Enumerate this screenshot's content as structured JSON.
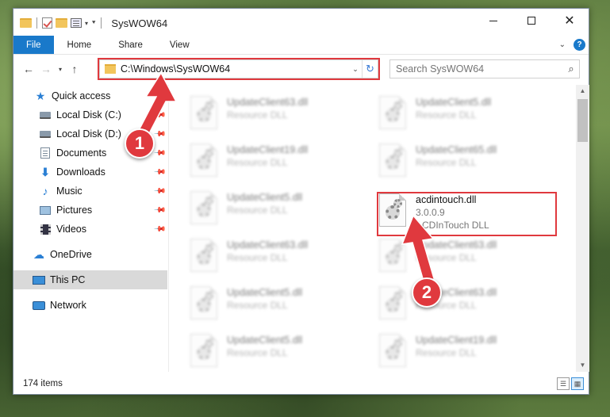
{
  "window": {
    "title": "SysWOW64"
  },
  "ribbon": {
    "tabs": [
      "File",
      "Home",
      "Share",
      "View"
    ]
  },
  "address": {
    "path": "C:\\Windows\\SysWOW64"
  },
  "search": {
    "placeholder": "Search SysWOW64"
  },
  "nav": {
    "quick_access": "Quick access",
    "items": [
      {
        "label": "Local Disk (C:)",
        "icon": "drive-icon"
      },
      {
        "label": "Local Disk (D:)",
        "icon": "drive-icon"
      },
      {
        "label": "Documents",
        "icon": "documents-icon"
      },
      {
        "label": "Downloads",
        "icon": "download-icon"
      },
      {
        "label": "Music",
        "icon": "music-icon"
      },
      {
        "label": "Pictures",
        "icon": "pictures-icon"
      },
      {
        "label": "Videos",
        "icon": "videos-icon"
      }
    ],
    "onedrive": "OneDrive",
    "this_pc": "This PC",
    "network": "Network"
  },
  "files": {
    "left": [
      {
        "name": "UpdateClient63.dll",
        "type": "Resource DLL"
      },
      {
        "name": "UpdateClient19.dll",
        "type": "Resource DLL"
      },
      {
        "name": "UpdateClient5.dll",
        "type": "Resource DLL"
      },
      {
        "name": "UpdateClient63.dll",
        "type": "Resource DLL"
      },
      {
        "name": "UpdateClient5.dll",
        "type": "Resource DLL"
      },
      {
        "name": "UpdateClient5.dll",
        "type": "Resource DLL"
      }
    ],
    "right": [
      {
        "name": "UpdateClient5.dll",
        "type": "Resource DLL"
      },
      {
        "name": "UpdateClient65.dll",
        "type": "Resource DLL"
      },
      {
        "name": "acdintouch.dll",
        "version": "3.0.0.9",
        "type": "ACDInTouch DLL"
      },
      {
        "name": "UpdateClient63.dll",
        "type": "Resource DLL"
      },
      {
        "name": "UpdateClient63.dll",
        "type": "Resource DLL"
      },
      {
        "name": "UpdateClient19.dll",
        "type": "Resource DLL"
      }
    ]
  },
  "status": {
    "item_count": "174 items"
  },
  "annotations": {
    "step1": "1",
    "step2": "2",
    "color": "#e0393e"
  }
}
